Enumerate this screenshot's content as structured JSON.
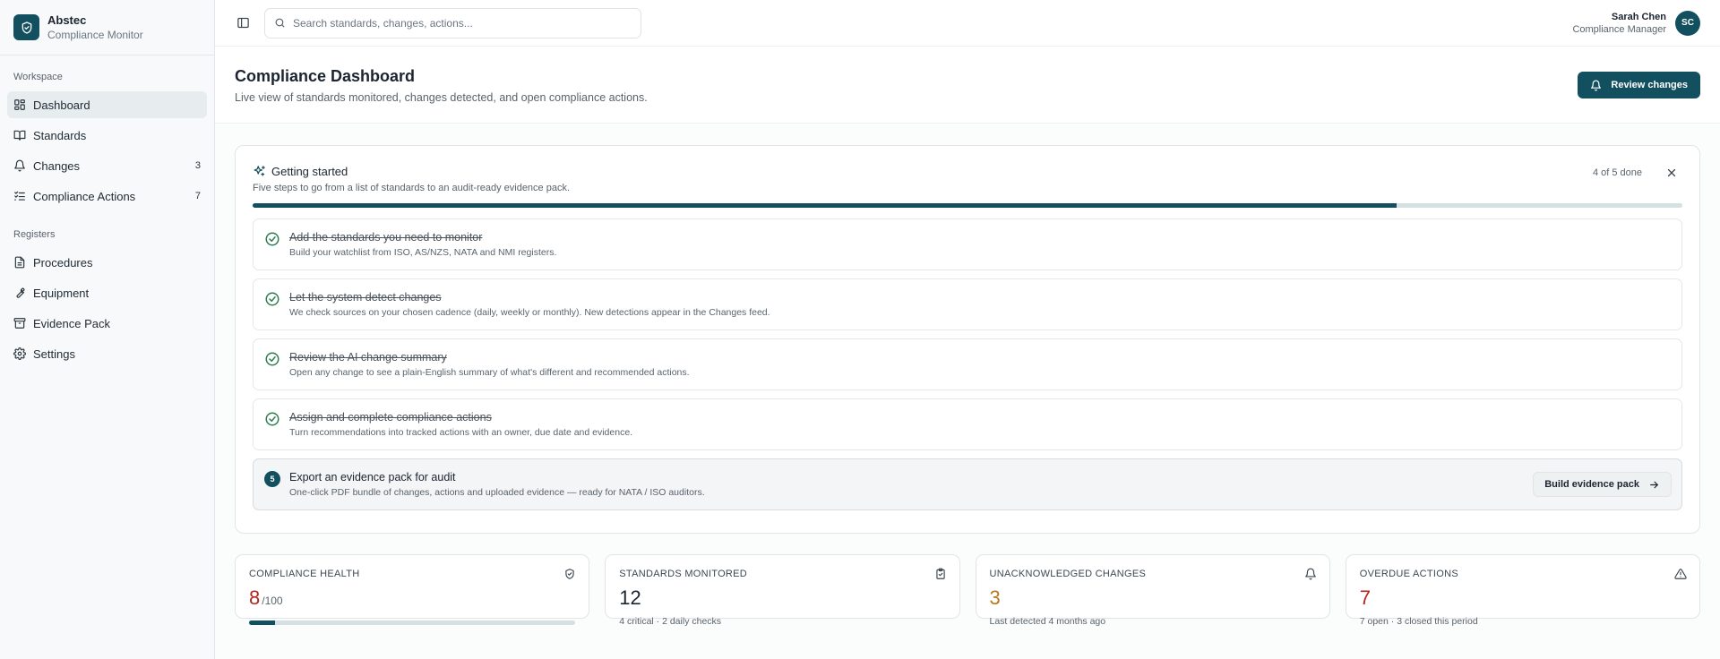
{
  "brand": {
    "name": "Abstec",
    "subtitle": "Compliance Monitor"
  },
  "sidebar": {
    "groups": [
      {
        "label": "Workspace",
        "items": [
          {
            "label": "Dashboard",
            "icon": "dashboard-icon",
            "active": true
          },
          {
            "label": "Standards",
            "icon": "book-icon"
          },
          {
            "label": "Changes",
            "icon": "bell-icon",
            "badge": "3"
          },
          {
            "label": "Compliance Actions",
            "icon": "checklist-icon",
            "badge": "7"
          }
        ]
      },
      {
        "label": "Registers",
        "items": [
          {
            "label": "Procedures",
            "icon": "document-icon"
          },
          {
            "label": "Equipment",
            "icon": "wrench-icon"
          },
          {
            "label": "Evidence Pack",
            "icon": "archive-icon"
          },
          {
            "label": "Settings",
            "icon": "gear-icon"
          }
        ]
      }
    ]
  },
  "topbar": {
    "search_placeholder": "Search standards, changes, actions...",
    "user": {
      "name": "Sarah Chen",
      "role": "Compliance Manager",
      "initials": "SC"
    }
  },
  "page": {
    "title": "Compliance Dashboard",
    "subtitle": "Live view of standards monitored, changes detected, and open compliance actions.",
    "review_button": "Review changes"
  },
  "getting_started": {
    "title": "Getting started",
    "subtitle": "Five steps to go from a list of standards to an audit-ready evidence pack.",
    "progress_text": "4 of 5 done",
    "progress_fraction": 0.8,
    "steps": [
      {
        "title": "Add the standards you need to monitor",
        "desc": "Build your watchlist from ISO, AS/NZS, NATA and NMI registers.",
        "done": true
      },
      {
        "title": "Let the system detect changes",
        "desc": "We check sources on your chosen cadence (daily, weekly or monthly). New detections appear in the Changes feed.",
        "done": true
      },
      {
        "title": "Review the AI change summary",
        "desc": "Open any change to see a plain-English summary of what's different and recommended actions.",
        "done": true
      },
      {
        "title": "Assign and complete compliance actions",
        "desc": "Turn recommendations into tracked actions with an owner, due date and evidence.",
        "done": true
      },
      {
        "title": "Export an evidence pack for audit",
        "desc": "One-click PDF bundle of changes, actions and uploaded evidence — ready for NATA / ISO auditors.",
        "done": false,
        "number": "5",
        "button": "Build evidence pack"
      }
    ]
  },
  "stats": [
    {
      "label": "COMPLIANCE HEALTH",
      "value": "8",
      "suffix": "/100",
      "icon": "shield-check-icon",
      "color": "#b3261e",
      "bar_fraction": 0.08
    },
    {
      "label": "STANDARDS MONITORED",
      "value": "12",
      "sub": "4 critical · 2 daily checks",
      "icon": "clipboard-check-icon",
      "color": "#1b2430"
    },
    {
      "label": "UNACKNOWLEDGED CHANGES",
      "value": "3",
      "sub": "Last detected 4 months ago",
      "icon": "bell-icon",
      "color": "#b7791f"
    },
    {
      "label": "OVERDUE ACTIONS",
      "value": "7",
      "sub": "7 open · 3 closed this period",
      "icon": "warning-triangle-icon",
      "color": "#b3261e"
    }
  ],
  "colors": {
    "brand": "#13505f",
    "danger": "#b3261e",
    "warning": "#b7791f",
    "success": "#2e7d4f"
  }
}
